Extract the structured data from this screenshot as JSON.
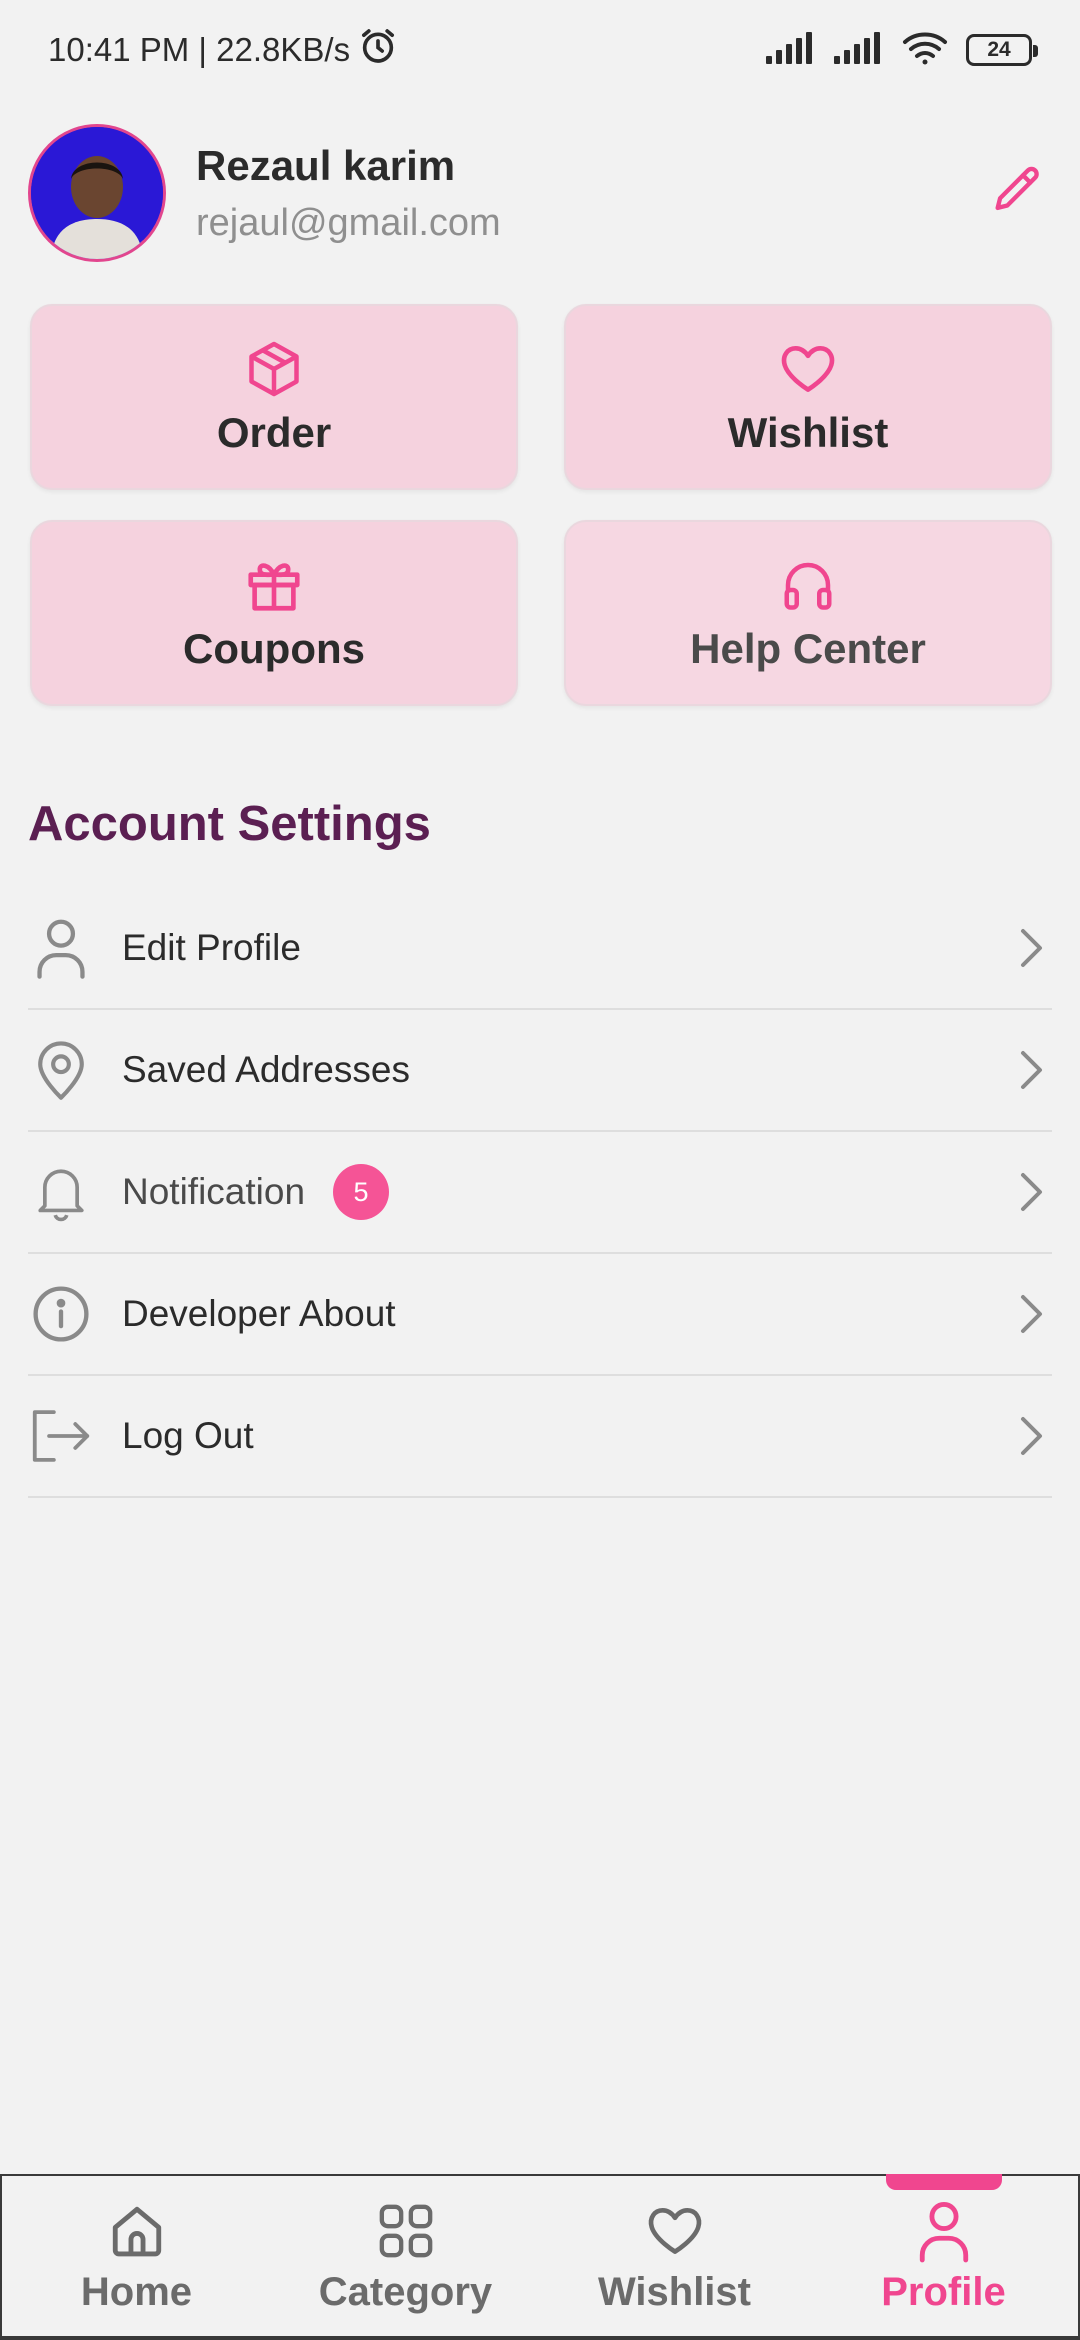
{
  "status_bar": {
    "time_speed": "10:41 PM | 22.8KB/s",
    "battery": "24"
  },
  "profile": {
    "name": "Rezaul karim",
    "email": "rejaul@gmail.com"
  },
  "cards": [
    {
      "label": "Order",
      "icon": "box-icon"
    },
    {
      "label": "Wishlist",
      "icon": "heart-icon"
    },
    {
      "label": "Coupons",
      "icon": "gift-icon"
    },
    {
      "label": "Help Center",
      "icon": "headphones-icon"
    }
  ],
  "account_settings": {
    "title": "Account Settings",
    "items": [
      {
        "label": "Edit Profile",
        "icon": "user-icon"
      },
      {
        "label": "Saved Addresses",
        "icon": "location-pin-icon"
      },
      {
        "label": "Notification",
        "icon": "bell-icon",
        "badge": "5"
      },
      {
        "label": "Developer About",
        "icon": "info-icon"
      },
      {
        "label": "Log Out",
        "icon": "logout-icon"
      }
    ]
  },
  "bottom_nav": {
    "items": [
      {
        "label": "Home",
        "icon": "home-icon"
      },
      {
        "label": "Category",
        "icon": "grid-icon"
      },
      {
        "label": "Wishlist",
        "icon": "heart-icon"
      },
      {
        "label": "Profile",
        "icon": "user-icon",
        "active": true
      }
    ]
  },
  "colors": {
    "accent": "#f0468f",
    "card_bg": "#f5d2de",
    "section_title": "#5b1f52",
    "badge": "#f55496"
  }
}
